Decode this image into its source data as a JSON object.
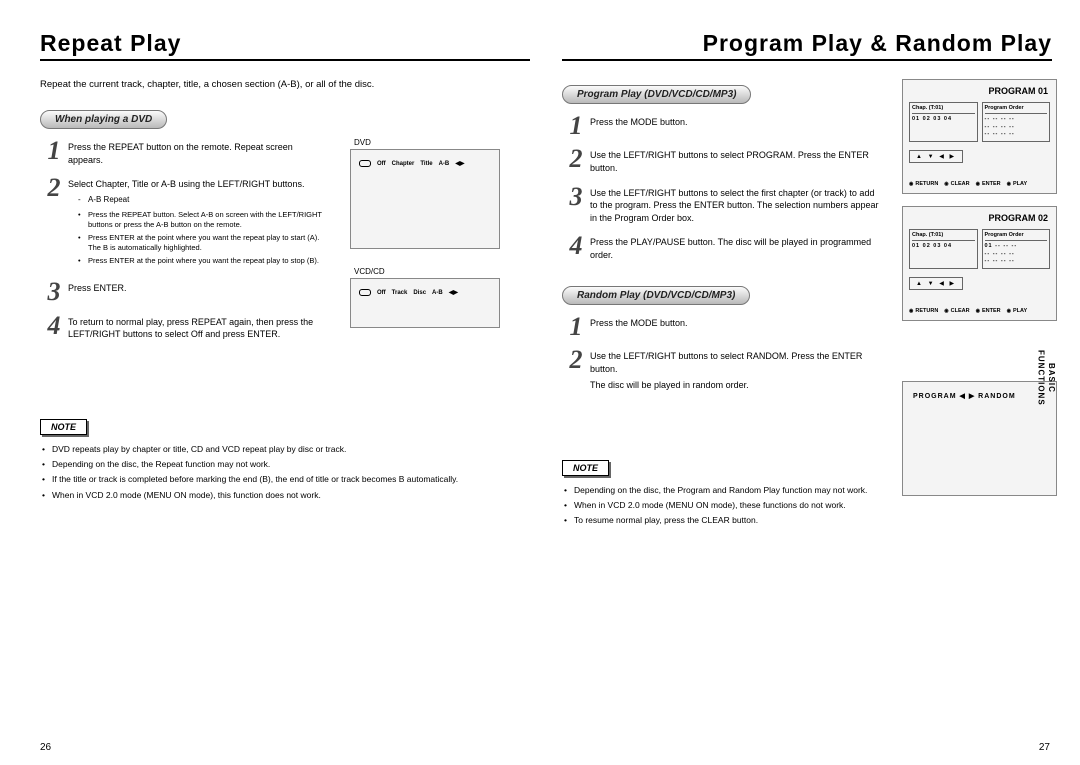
{
  "left": {
    "title": "Repeat Play",
    "intro": "Repeat the current track, chapter, title, a chosen section (A-B), or all of the disc.",
    "subheading": "When playing a DVD",
    "steps": [
      "Press the REPEAT button on the remote. Repeat screen appears.",
      "Select Chapter, Title or A-B using the LEFT/RIGHT buttons.",
      "Press ENTER.",
      "To return to normal play, press REPEAT again, then press the LEFT/RIGHT buttons to select Off and press ENTER."
    ],
    "ab_title": "A-B Repeat",
    "ab_bullets": [
      "Press the REPEAT button. Select A-B on screen with the LEFT/RIGHT buttons or press the A-B button on the remote.",
      "Press ENTER at the point where you want the repeat play to start (A). The B is automatically highlighted.",
      "Press ENTER at the point where you want the repeat play to stop (B)."
    ],
    "screen1_label": "DVD",
    "screen1_bar": [
      "Off",
      "Chapter",
      "Title",
      "A-B"
    ],
    "screen2_label": "VCD/CD",
    "screen2_bar": [
      "Off",
      "Track",
      "Disc",
      "A-B"
    ],
    "note_label": "NOTE",
    "notes": [
      "DVD repeats play by chapter or title, CD and VCD repeat play by disc or track.",
      "Depending on the disc, the Repeat function may not work.",
      "If the title or track is completed before marking the end (B), the end of title or track becomes B automatically.",
      "When in VCD 2.0 mode (MENU ON mode), this function does not work."
    ],
    "page_num": "26"
  },
  "right": {
    "title": "Program Play & Random Play",
    "section1": "Program Play (DVD/VCD/CD/MP3)",
    "steps1": [
      "Press the MODE button.",
      "Use the LEFT/RIGHT buttons to select PROGRAM. Press the ENTER button.",
      "Use the LEFT/RIGHT buttons to select the first chapter (or track) to add to the program. Press the ENTER button. The selection numbers appear in the Program Order box.",
      "Press the PLAY/PAUSE button. The disc will be played in programmed order."
    ],
    "section2": "Random Play (DVD/VCD/CD/MP3)",
    "steps2": [
      "Press the MODE button.",
      "Use the LEFT/RIGHT buttons to select RANDOM. Press the ENTER button."
    ],
    "random_end": "The disc will be played in random order.",
    "prog1_title": "PROGRAM 01",
    "prog2_title": "PROGRAM 02",
    "panel_chap": "Chap. (T:01)",
    "panel_order": "Program Order",
    "panel_row1": "01 02 03 04",
    "panel_row2": "01",
    "footer_return": "RETURN",
    "footer_clear": "CLEAR",
    "footer_enter": "ENTER",
    "footer_play": "PLAY",
    "rand_bar": "PROGRAM   ◀ ▶   RANDOM",
    "note_label": "NOTE",
    "notes": [
      "Depending on the disc, the Program and Random Play function may not work.",
      "When in VCD 2.0 mode (MENU ON mode), these functions do not work.",
      "To resume normal play, press the CLEAR button."
    ],
    "page_num": "27",
    "side_tab": "BASIC\nFUNCTIONS"
  }
}
